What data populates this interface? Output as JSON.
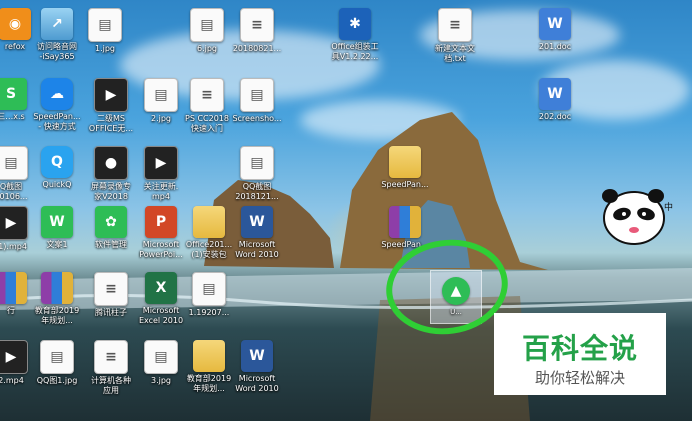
{
  "desktop": {
    "icons": [
      {
        "label": "refox",
        "icon": "firefox-icon"
      },
      {
        "label": "访问略音网\n-iSay365",
        "icon": "shortcut-icon"
      },
      {
        "label": "1.jpg",
        "icon": "image-file-icon"
      },
      {
        "label": "6.jpg",
        "icon": "image-file-icon"
      },
      {
        "label": "20180821...",
        "icon": "document-icon"
      },
      {
        "label": "Office组装工\n具V1.2.22...",
        "icon": "tool-icon"
      },
      {
        "label": "新建文本文\n档.txt",
        "icon": "text-file-icon"
      },
      {
        "label": "201.doc",
        "icon": "word-doc-icon"
      },
      {
        "label": "三…x.s",
        "icon": "wps-icon"
      },
      {
        "label": "SpeedPan...\n- 快速方式",
        "icon": "speedpan-icon"
      },
      {
        "label": "二级MS\nOFFICE无...",
        "icon": "office-icon"
      },
      {
        "label": "2.jpg",
        "icon": "image-file-icon"
      },
      {
        "label": "PS CC2018\n快速入门",
        "icon": "document-icon"
      },
      {
        "label": "Screensho...",
        "icon": "image-file-icon"
      },
      {
        "label": "202.doc",
        "icon": "word-doc-icon"
      },
      {
        "label": "Q截图\n30106...",
        "icon": "image-file-icon"
      },
      {
        "label": "QuickQ",
        "icon": "quickq-icon"
      },
      {
        "label": "屏幕录像专\n家V2018",
        "icon": "recorder-icon"
      },
      {
        "label": "关注更新.\nmp4",
        "icon": "video-file-icon"
      },
      {
        "label": "QQ截图\n2018121...",
        "icon": "image-file-icon"
      },
      {
        "label": "SpeedPan...",
        "icon": "folder-icon"
      },
      {
        "label": "(1).mp4",
        "icon": "video-file-icon"
      },
      {
        "label": "文案1",
        "icon": "wps-doc-icon"
      },
      {
        "label": "软件管理",
        "icon": "software-manager-icon"
      },
      {
        "label": "Microsoft\nPowerPoi...",
        "icon": "powerpoint-icon"
      },
      {
        "label": "Office201...\n(1)安装包",
        "icon": "folder-icon"
      },
      {
        "label": "Microsoft\nWord 2010",
        "icon": "word-icon"
      },
      {
        "label": "SpeedPan...",
        "icon": "archive-icon"
      },
      {
        "label": "行",
        "icon": "archive-icon"
      },
      {
        "label": "教育部2019\n年规划...",
        "icon": "archive-icon"
      },
      {
        "label": "腾讯柱子",
        "icon": "document-icon"
      },
      {
        "label": "Microsoft\nExcel 2010",
        "icon": "excel-icon"
      },
      {
        "label": "1.19207...",
        "icon": "image-file-icon"
      },
      {
        "label": "2.mp4",
        "icon": "video-file-icon"
      },
      {
        "label": "QQ图1.jpg",
        "icon": "image-file-icon"
      },
      {
        "label": "计算机各种\n应用",
        "icon": "document-icon"
      },
      {
        "label": "3.jpg",
        "icon": "image-file-icon"
      },
      {
        "label": "教育部2019\n年规划...",
        "icon": "folder-icon"
      },
      {
        "label": "Microsoft\nWord 2010",
        "icon": "word-icon"
      }
    ],
    "dragged_icon": {
      "label": "U...",
      "icon": "shortcut-icon"
    },
    "highlight_color": "#2fce35"
  },
  "watermark": {
    "title": "百科全说",
    "subtitle": "助你轻松解决",
    "title_color": "#24a149"
  },
  "sticker": {
    "text": "中",
    "icon": "panda-sticker-icon"
  }
}
